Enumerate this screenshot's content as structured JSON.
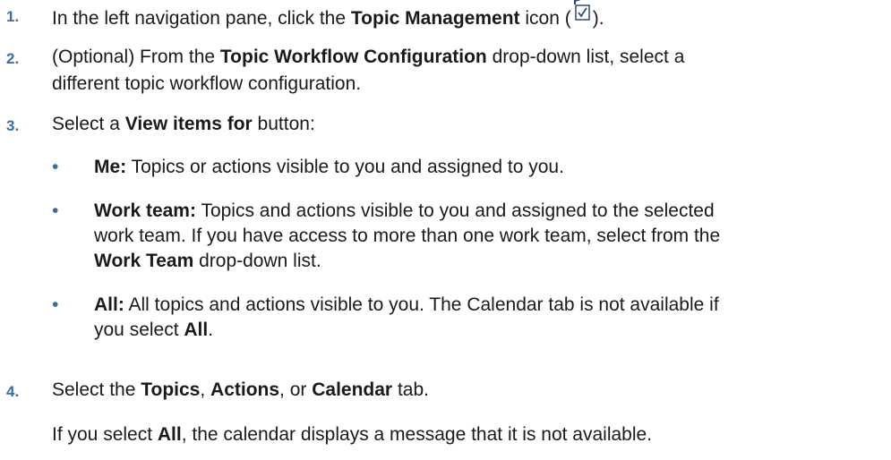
{
  "steps": [
    {
      "number": "1.",
      "pre": "In the left navigation pane, click the ",
      "bold": "Topic Management",
      "post_before_icon": " icon (",
      "post_after_icon": ").",
      "icon": "topic-management-icon"
    },
    {
      "number": "2.",
      "pre": "(Optional) From the ",
      "bold": "Topic Workflow Configuration",
      "post": " drop-down list, select a",
      "line2": "different topic workflow configuration."
    },
    {
      "number": "3.",
      "pre": "Select a ",
      "bold": "View items for",
      "post": " button:",
      "bullets": [
        {
          "bold": "Me:",
          "text": " Topics or actions visible to you and assigned to you."
        },
        {
          "bold": "Work team:",
          "text": " Topics and actions visible to you and assigned to the selected",
          "line2": "work team. If you have access to more than one work team, select from the",
          "line3_bold": "Work Team",
          "line3": " drop-down list."
        },
        {
          "bold": "All:",
          "text": " All topics and actions visible to you. The Calendar tab is not available if",
          "line2_pre": "you select ",
          "line2_bold": "All",
          "line2_post": "."
        }
      ]
    },
    {
      "number": "4.",
      "pre": "Select the ",
      "bold1": "Topics",
      "sep1": ", ",
      "bold2": "Actions",
      "sep2": ", or ",
      "bold3": "Calendar",
      "post": " tab.",
      "note_pre": "If you select ",
      "note_bold": "All",
      "note_post": ", the calendar displays a message that it is not available."
    }
  ],
  "bullet_glyph": "•",
  "colors": {
    "accent": "#3a6ea5",
    "text": "#1a1a1a"
  }
}
